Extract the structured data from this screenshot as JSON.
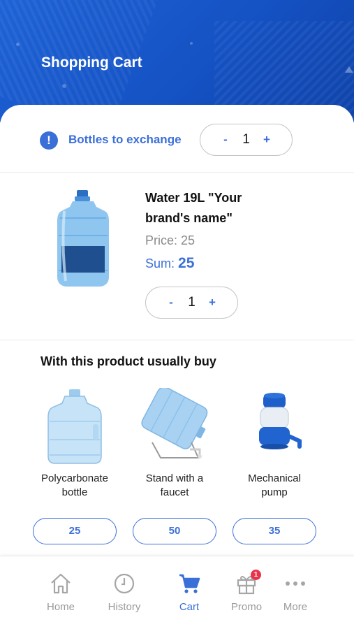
{
  "header": {
    "title": "Shopping Cart"
  },
  "exchange": {
    "label": "Bottles to exchange",
    "minus": "-",
    "plus": "+",
    "quantity": "1"
  },
  "product": {
    "name": "Water 19L \"Your brand's name\"",
    "price_label": "Price: 25",
    "sum_prefix": "Sum:",
    "sum_value": "25",
    "minus": "-",
    "plus": "+",
    "quantity": "1"
  },
  "recommendations": {
    "title": "With this product usually buy",
    "items": [
      {
        "name_line1": "Polycarbonate",
        "name_line2": "bottle",
        "price": "25"
      },
      {
        "name_line1": "Stand with a",
        "name_line2": "faucet",
        "price": "50"
      },
      {
        "name_line1": "Mechanical",
        "name_line2": "pump",
        "price": "35"
      }
    ]
  },
  "nav": {
    "items": [
      {
        "label": "Home",
        "icon": "home-icon"
      },
      {
        "label": "History",
        "icon": "clock-icon"
      },
      {
        "label": "Cart",
        "icon": "cart-icon"
      },
      {
        "label": "Promo",
        "icon": "gift-icon",
        "badge": "1"
      },
      {
        "label": "More",
        "icon": "more-icon"
      }
    ]
  },
  "colors": {
    "accent": "#3b6fd8",
    "header": "#1552c4",
    "badge": "#e8334a"
  }
}
